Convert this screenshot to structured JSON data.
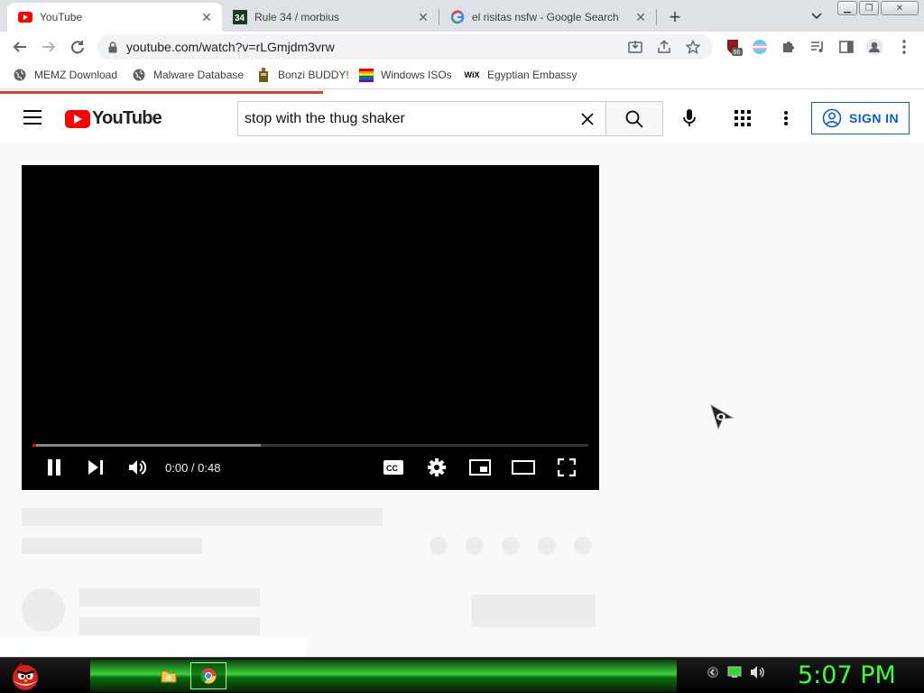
{
  "browser": {
    "tabs": [
      {
        "title": "YouTube",
        "active": true
      },
      {
        "title": "Rule 34 / morbius",
        "active": false
      },
      {
        "title": "el risitas nsfw - Google Search",
        "active": false
      }
    ],
    "address": "youtube.com/watch?v=rLGmjdm3vrw",
    "extension_badge": "66",
    "bookmarks": [
      {
        "label": "MEMZ Download",
        "icon": "globe-icon"
      },
      {
        "label": "Malware Database",
        "icon": "globe-icon"
      },
      {
        "label": "Bonzi BUDDY!",
        "icon": "bonzi-icon"
      },
      {
        "label": "Windows ISOs",
        "icon": "windows-flag-icon"
      },
      {
        "label": "Egyptian Embassy",
        "icon": "wix-icon"
      }
    ],
    "load_progress": 0.35
  },
  "youtube": {
    "logo_text": "YouTube",
    "search_value": "stop with the thug shaker",
    "signin_label": "SIGN IN",
    "player": {
      "time_current": "0:00",
      "time_total": "0:48",
      "time_display": "0:00 / 0:48",
      "played_fraction": 0.0,
      "buffered_fraction": 0.41
    }
  },
  "taskbar": {
    "clock": "5:07 PM"
  },
  "colors": {
    "youtube_red": "#ff0000",
    "signin_blue": "#065fd4",
    "clock_green": "#3aff3a",
    "load_bar_red": "#e53935"
  }
}
